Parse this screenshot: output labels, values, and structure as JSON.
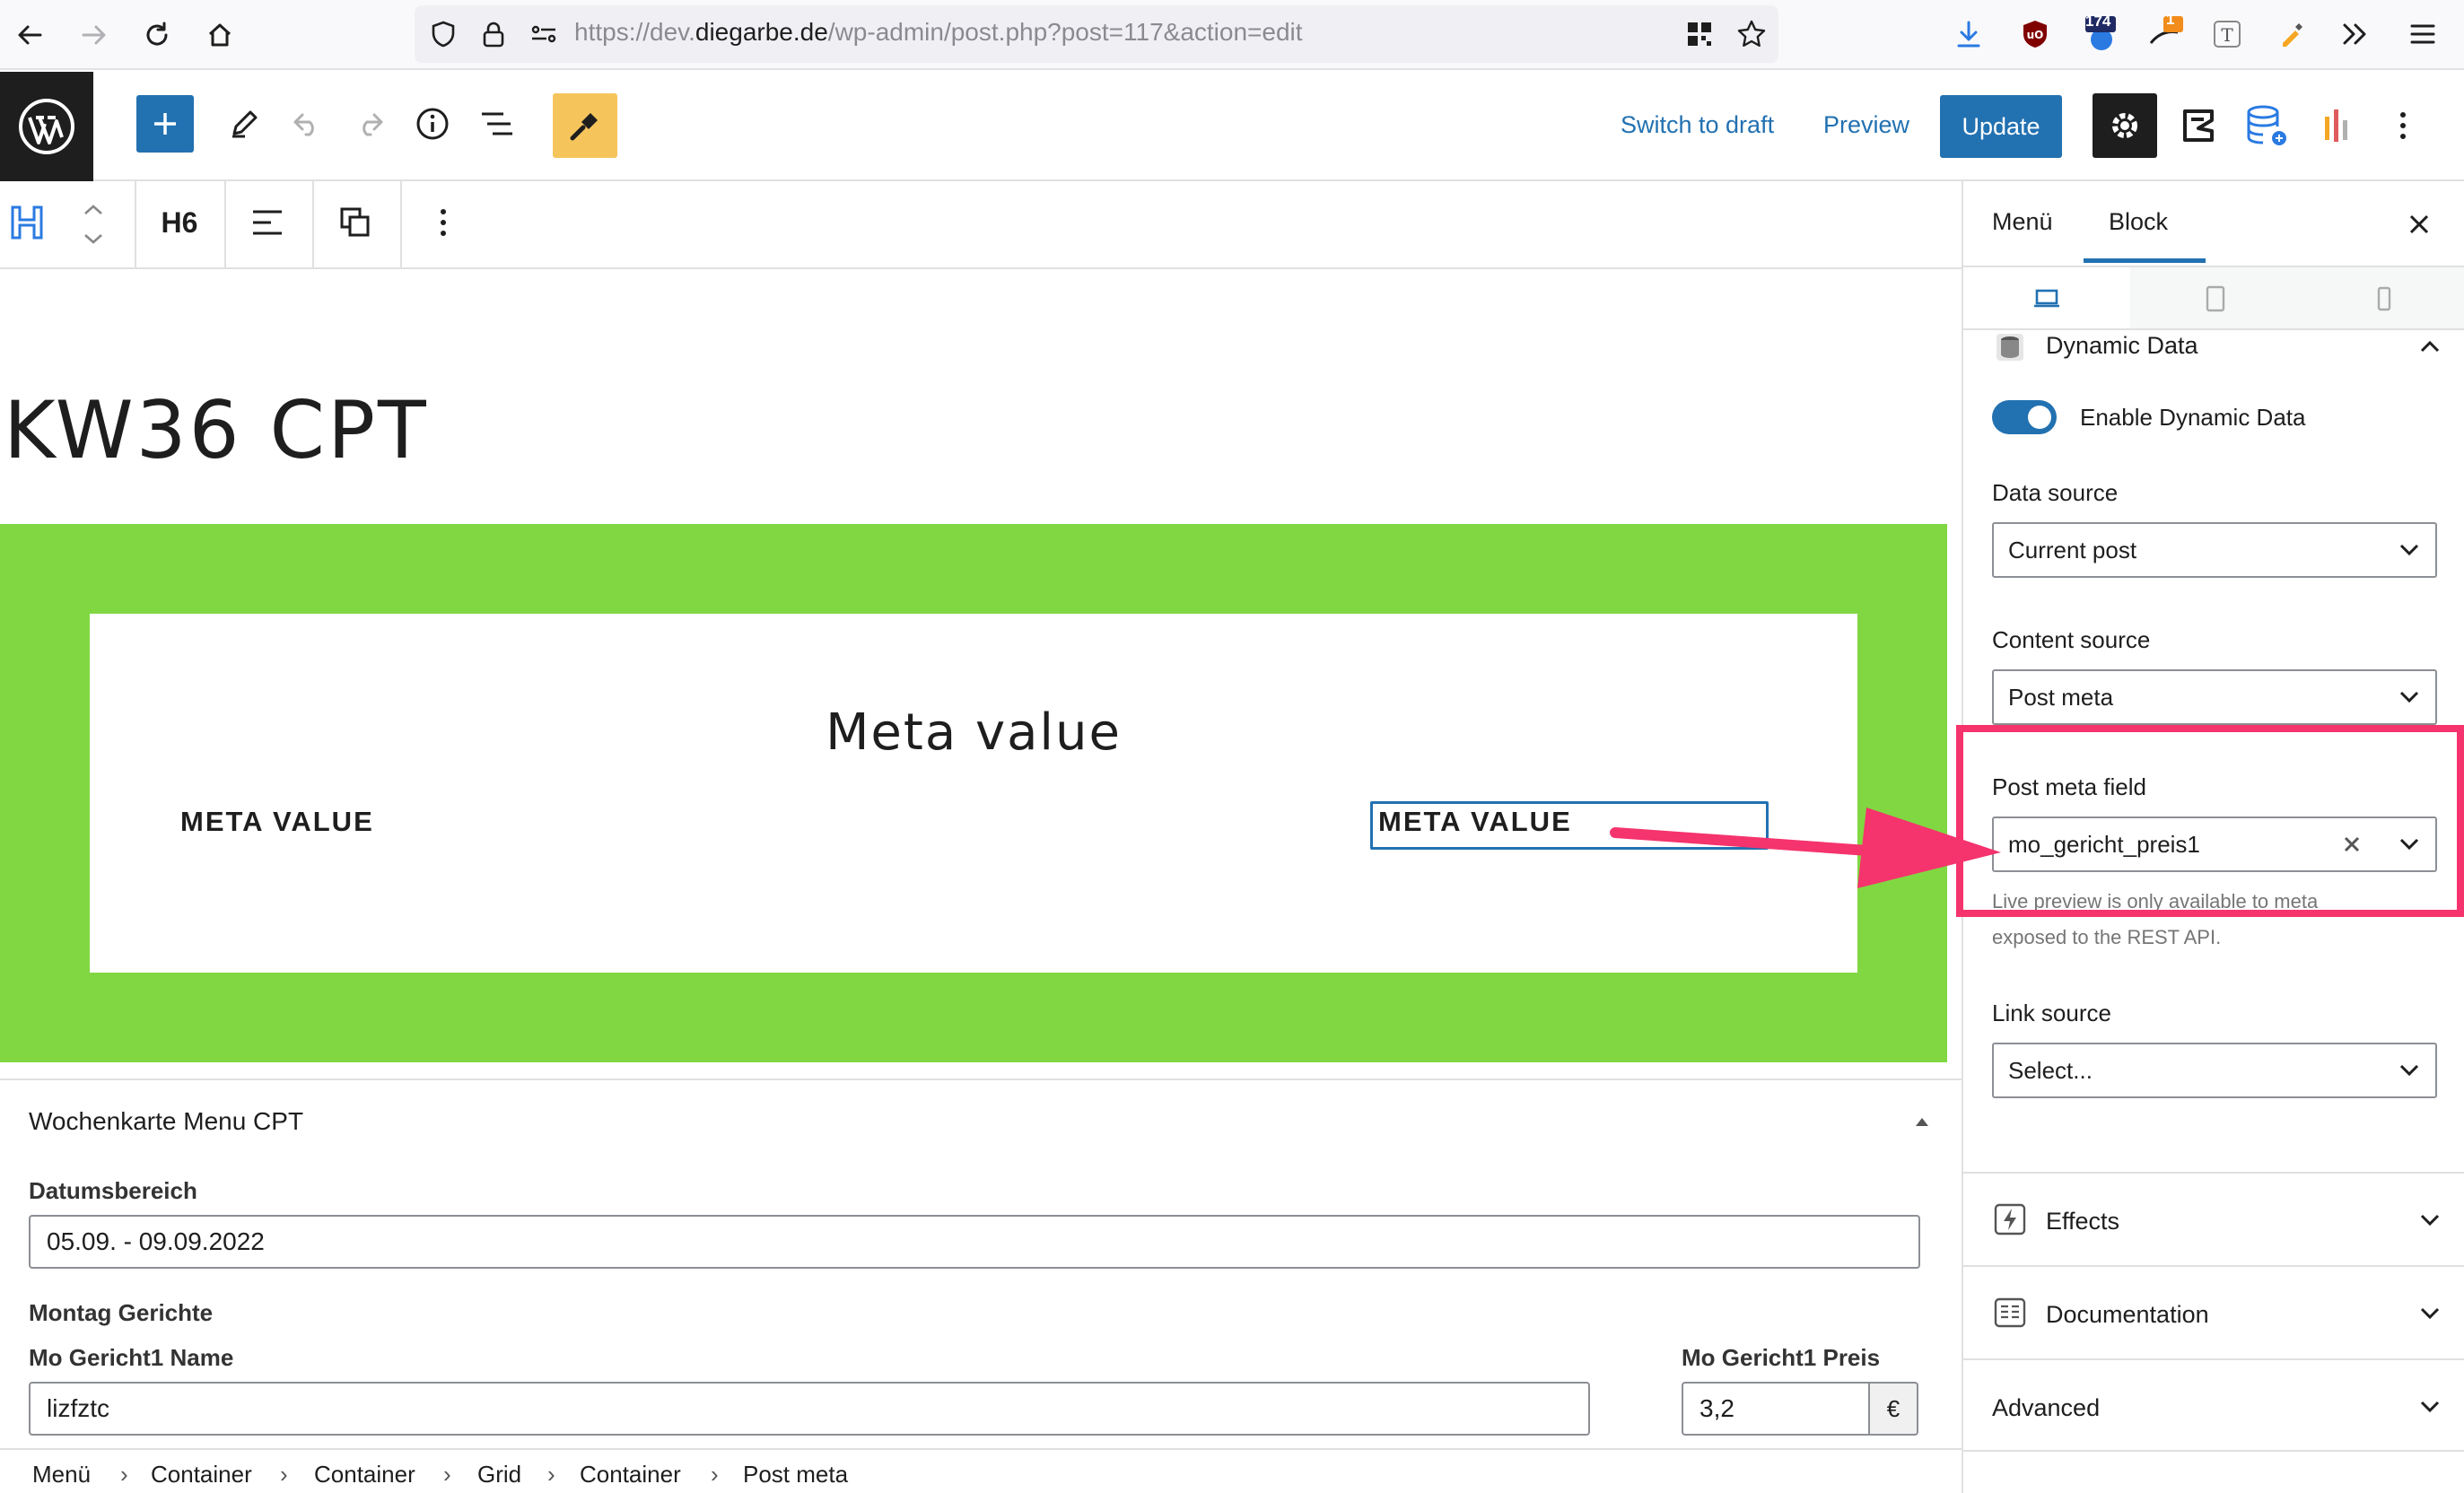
{
  "browser": {
    "url_prefix": "https://dev.",
    "url_domain": "diegarbe.de",
    "url_path": "/wp-admin/post.php?post=117&action=edit",
    "ext_badge_count": "174",
    "ext_badge_count2": "1"
  },
  "toolbar": {
    "switch_to_draft": "Switch to draft",
    "preview": "Preview",
    "update": "Update"
  },
  "block_toolbar": {
    "heading_level": "H6"
  },
  "canvas": {
    "page_title": "KW36 CPT",
    "meta_heading": "Meta value",
    "meta_left": "META VALUE",
    "meta_right": "META VALUE"
  },
  "metabox": {
    "title": "Wochenkarte Menu CPT",
    "date_range_label": "Datumsbereich",
    "date_range_value": "05.09. - 09.09.2022",
    "monday_label": "Montag Gerichte",
    "mo_name_label": "Mo Gericht1 Name",
    "mo_name_value": "lizfztc",
    "mo_price_label": "Mo Gericht1 Preis",
    "mo_price_value": "3,2",
    "currency": "€"
  },
  "breadcrumb": [
    "Menü",
    "Container",
    "Container",
    "Grid",
    "Container",
    "Post meta"
  ],
  "sidebar": {
    "tab_menu": "Menü",
    "tab_block": "Block",
    "dynamic_data_title": "Dynamic Data",
    "enable_dynamic_label": "Enable Dynamic Data",
    "enable_dynamic_on": true,
    "data_source_label": "Data source",
    "data_source_value": "Current post",
    "content_source_label": "Content source",
    "content_source_value": "Post meta",
    "post_meta_field_label": "Post meta field",
    "post_meta_field_value": "mo_gericht_preis1",
    "help_text_line1": "Live preview is only available to meta",
    "help_text_line2": "exposed to the REST API.",
    "link_source_label": "Link source",
    "link_source_value": "Select...",
    "effects": "Effects",
    "documentation": "Documentation",
    "advanced": "Advanced"
  },
  "colors": {
    "accent": "#2271b1",
    "green": "#81d742",
    "highlight": "#f5336d",
    "brush_button": "#f5c55c"
  }
}
